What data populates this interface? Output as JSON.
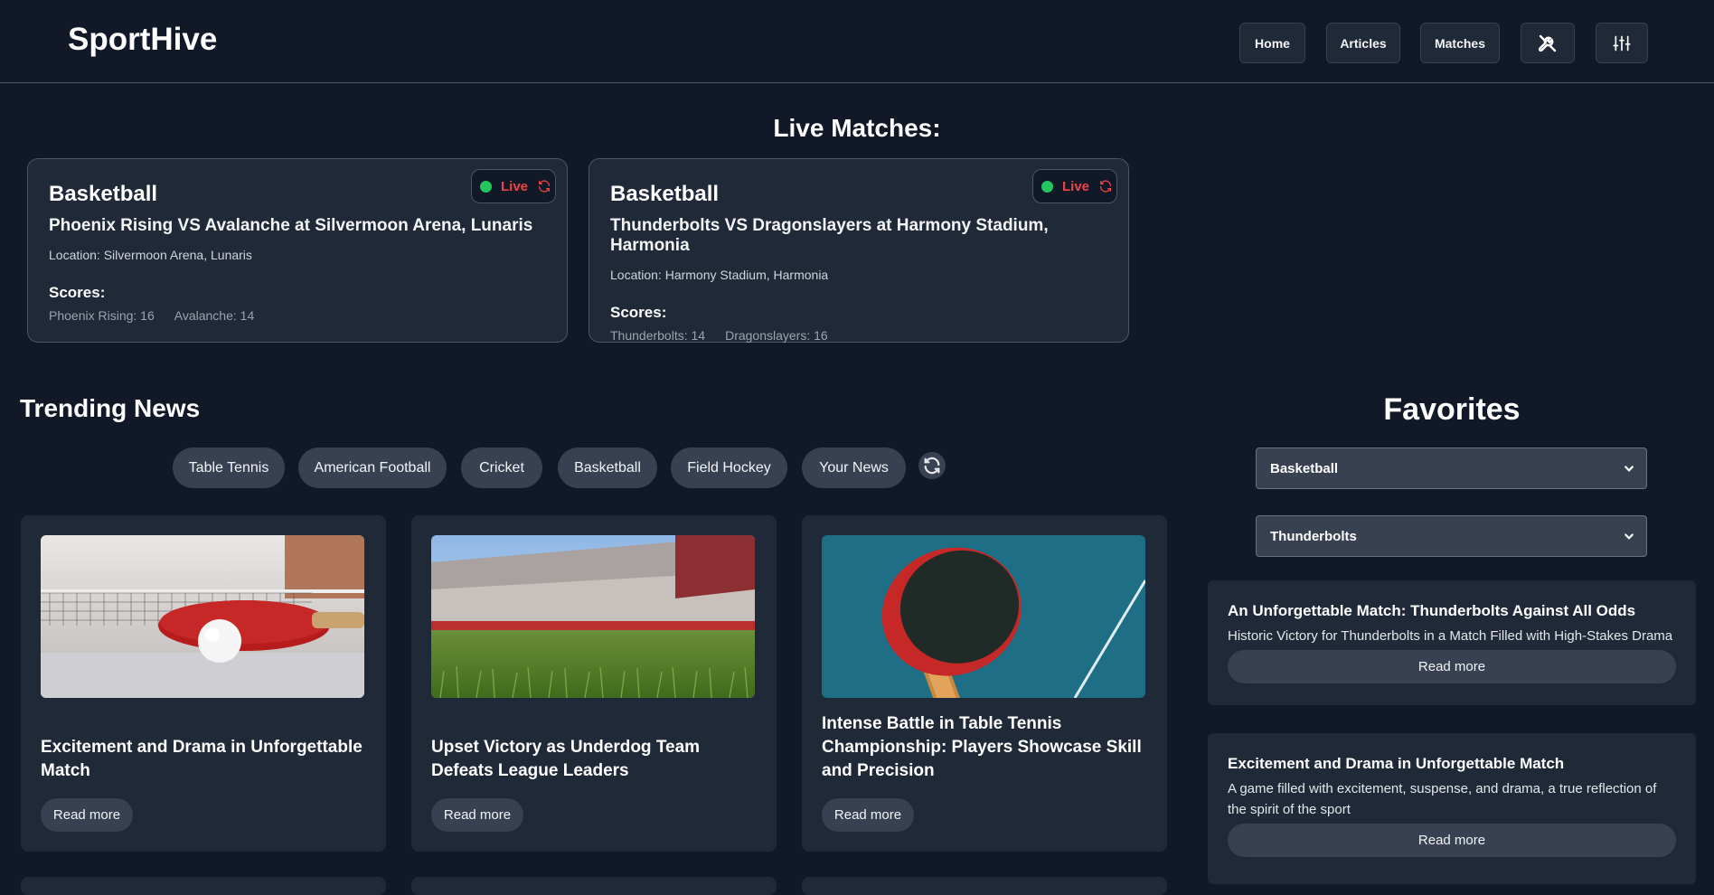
{
  "header": {
    "logo": "SportHive",
    "nav": [
      {
        "label": "Home"
      },
      {
        "label": "Articles"
      },
      {
        "label": "Matches"
      }
    ],
    "icons": [
      "tools-icon",
      "sliders-icon"
    ]
  },
  "live": {
    "title": "Live Matches:",
    "matches": [
      {
        "sport": "Basketball",
        "title": "Phoenix Rising VS Avalanche at Silvermoon Arena, Lunaris",
        "location": "Location: Silvermoon Arena, Lunaris",
        "badge": "Live",
        "scores_label": "Scores:",
        "score_a": "Phoenix Rising: 16",
        "score_b": "Avalanche: 14"
      },
      {
        "sport": "Basketball",
        "title": "Thunderbolts VS Dragonslayers at Harmony Stadium, Harmonia",
        "location": "Location: Harmony Stadium, Harmonia",
        "badge": "Live",
        "scores_label": "Scores:",
        "score_a": "Thunderbolts: 14",
        "score_b": "Dragonslayers: 16"
      }
    ]
  },
  "trending": {
    "title": "Trending News",
    "filters": [
      "Table Tennis",
      "American Football",
      "Cricket",
      "Basketball",
      "Field Hockey",
      "Your News"
    ],
    "articles": [
      {
        "title": "Excitement and Drama in Unforgettable Match",
        "read_more": "Read more"
      },
      {
        "title": "Upset Victory as Underdog Team Defeats League Leaders",
        "read_more": "Read more"
      },
      {
        "title": "Intense Battle in Table Tennis Championship: Players Showcase Skill and Precision",
        "read_more": "Read more"
      }
    ]
  },
  "favorites": {
    "title": "Favorites",
    "sport_select": "Basketball",
    "team_select": "Thunderbolts",
    "items": [
      {
        "title": "An Unforgettable Match: Thunderbolts Against All Odds",
        "desc": "Historic Victory for Thunderbolts in a Match Filled with High-Stakes Drama",
        "read_more": "Read more"
      },
      {
        "title": "Excitement and Drama in Unforgettable Match",
        "desc": "A game filled with excitement, suspense, and drama, a true reflection of the spirit of the sport",
        "read_more": "Read more"
      }
    ]
  },
  "colors": {
    "background": "#111827",
    "card": "#1f2937",
    "pill": "#374151",
    "live_red": "#ef4444",
    "live_green": "#22c55e"
  }
}
